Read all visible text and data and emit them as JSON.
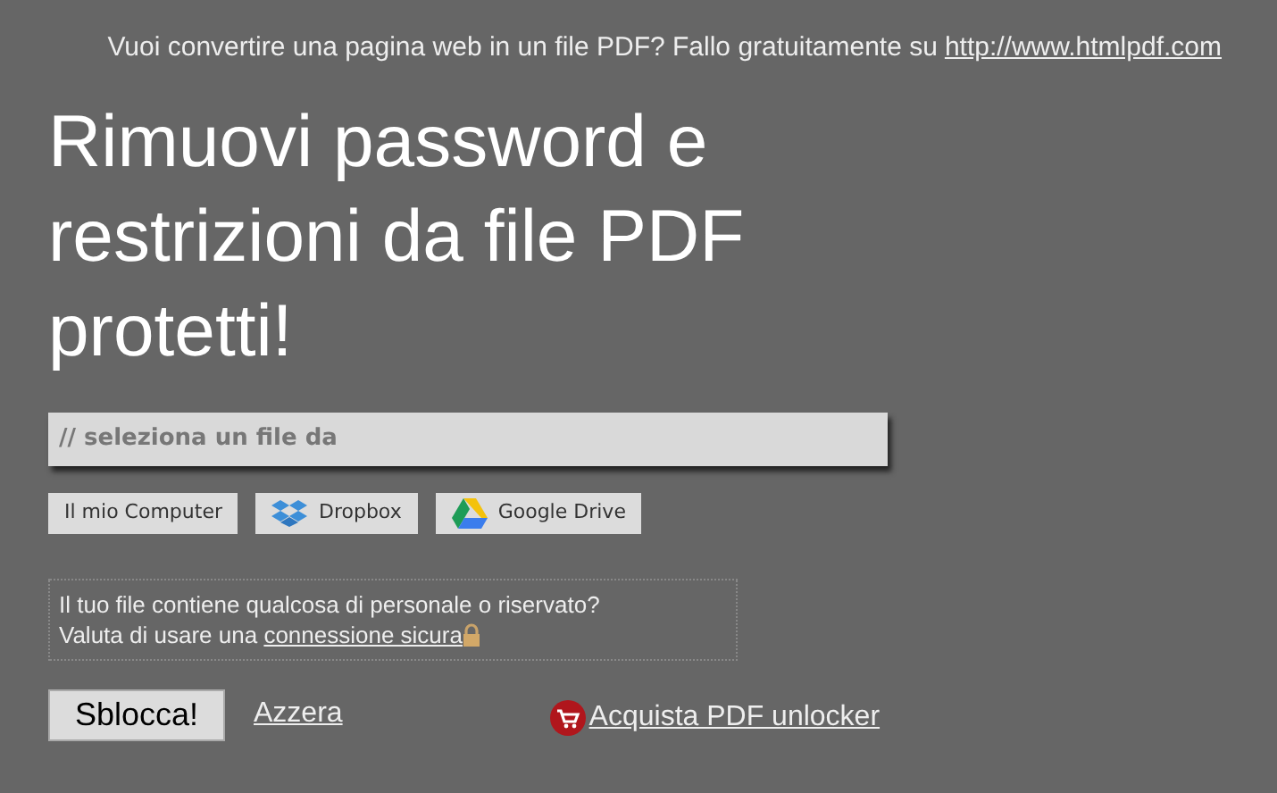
{
  "banner": {
    "text": "Vuoi convertire una pagina web in un file PDF? Fallo gratuitamente su",
    "link": "http://www.htmlpdf.com"
  },
  "title": "Rimuovi password e restrizioni da file PDF protetti!",
  "file_field": {
    "placeholder": "// seleziona un file da"
  },
  "sources": [
    {
      "kind": "plain",
      "label": "Il mio Computer"
    },
    {
      "kind": "dropbox",
      "label": "Dropbox"
    },
    {
      "kind": "drive",
      "label": "Google Drive"
    }
  ],
  "notice": {
    "line1": "Il tuo file contiene qualcosa di personale o riservato?",
    "line2": "Valuta di usare una",
    "link": "connessione sicura"
  },
  "actions": {
    "submit": "Sblocca!",
    "reset": "Azzera",
    "buy": "Acquista PDF unlocker"
  }
}
